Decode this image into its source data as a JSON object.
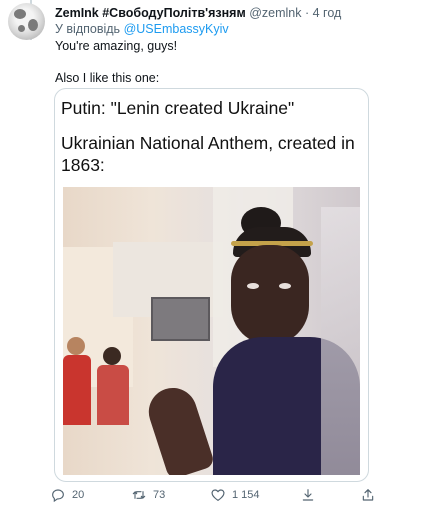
{
  "tweet": {
    "display_name": "ZemInk #СвободуПолітв'язням",
    "handle": "@zemlnk",
    "separator": "·",
    "time": "4 год",
    "reply_prefix": "У відповідь",
    "reply_handle": "@USEmbassyKyiv",
    "text": "You're amazing, guys!",
    "text2": "Also I like this one:"
  },
  "meme": {
    "line1": "Putin: \"Lenin created Ukraine\"",
    "line2": "Ukrainian National Anthem, created in 1863:"
  },
  "actions": {
    "replies": "20",
    "retweets": "73",
    "likes": "1 154"
  },
  "colors": {
    "link": "#1d9bf0",
    "secondary_text": "#536471",
    "border": "#cfd9de"
  }
}
